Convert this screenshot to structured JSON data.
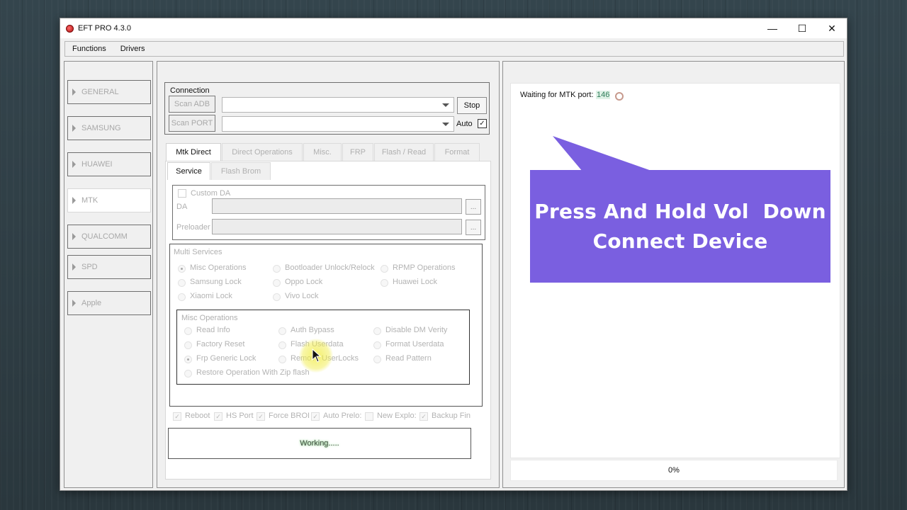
{
  "window": {
    "title": "EFT PRO 4.3.0",
    "controls": {
      "minimize": "—",
      "maximize": "☐",
      "close": "✕"
    }
  },
  "menu": [
    "Functions",
    "Drivers"
  ],
  "sidebar": {
    "items": [
      {
        "label": "GENERAL"
      },
      {
        "label": "SAMSUNG"
      },
      {
        "label": "HUAWEI"
      },
      {
        "label": "MTK",
        "active": true
      },
      {
        "label": "QUALCOMM"
      },
      {
        "label": "SPD"
      },
      {
        "label": "Apple"
      }
    ]
  },
  "connection": {
    "title": "Connection",
    "scan_adb": "Scan ADB",
    "scan_port": "Scan PORT",
    "adb_value": "",
    "port_value": "",
    "stop": "Stop",
    "auto_label": "Auto",
    "auto_checked": "✓"
  },
  "tabs": [
    "Mtk Direct",
    "Direct Operations",
    "Misc.",
    "FRP",
    "Flash / Read",
    "Format"
  ],
  "subtabs": [
    "Service",
    "Flash Brom"
  ],
  "custom_da": {
    "label": "Custom DA",
    "da_label": "DA",
    "preloader_label": "Preloader",
    "browse": "..."
  },
  "multi_services": {
    "title": "Multi Services",
    "options": [
      "Misc Operations",
      "Bootloader Unlock/Relock",
      "RPMP Operations",
      "Samsung Lock",
      "Oppo Lock",
      "Huawei Lock",
      "Xiaomi Lock",
      "Vivo Lock"
    ],
    "selected": "Misc Operations"
  },
  "misc_operations": {
    "title": "Misc Operations",
    "options": [
      "Read Info",
      "Auth Bypass",
      "Disable DM Verity",
      "Factory Reset",
      "Flash Userdata",
      "Format Userdata",
      "Frp Generic Lock",
      "Remove UserLocks",
      "Read Pattern",
      "Restore Operation With Zip flash"
    ],
    "selected": "Frp Generic Lock"
  },
  "bottom_checks": [
    {
      "label": "Reboot",
      "checked": true
    },
    {
      "label": "HS Port",
      "checked": true
    },
    {
      "label": "Force BROI",
      "checked": true
    },
    {
      "label": "Auto Prelo:",
      "checked": true
    },
    {
      "label": "New Explo:",
      "checked": false
    },
    {
      "label": "Backup Fin",
      "checked": true
    }
  ],
  "status": {
    "text": "Working....."
  },
  "log": {
    "waiting_label": "Waiting for MTK port:",
    "counter": "146"
  },
  "progress": {
    "value": 0,
    "text": "0%"
  },
  "callout": {
    "line1": "Press And Hold Vol  Down",
    "line2": "Connect Device",
    "color": "#7a5fe0"
  }
}
